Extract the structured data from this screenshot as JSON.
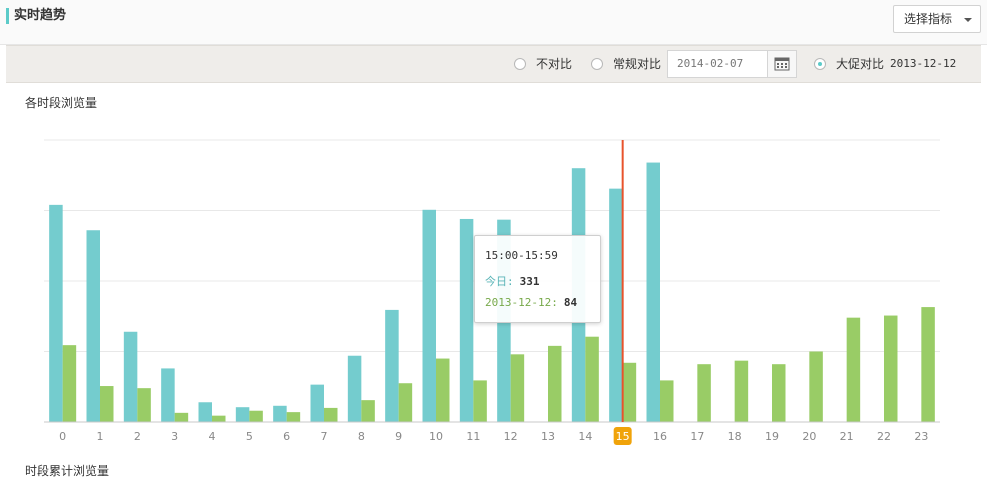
{
  "header": {
    "title": "实时趋势",
    "select_label": "选择指标"
  },
  "compare": {
    "options": [
      {
        "label": "不对比",
        "checked": false
      },
      {
        "label": "常规对比",
        "checked": false
      },
      {
        "label": "大促对比",
        "checked": true
      }
    ],
    "regular_date": "2014-02-07",
    "promo_date": "2013-12-12"
  },
  "sections": {
    "hourly_title": "各时段浏览量",
    "cumulative_title": "时段累计浏览量"
  },
  "colors": {
    "today": "#74ccce",
    "compare": "#99cc66",
    "marker": "#e8532c",
    "highlight": "#f0a30a"
  },
  "chart_data": {
    "type": "bar",
    "categories": [
      "0",
      "1",
      "2",
      "3",
      "4",
      "5",
      "6",
      "7",
      "8",
      "9",
      "10",
      "11",
      "12",
      "13",
      "14",
      "15",
      "16",
      "17",
      "18",
      "19",
      "20",
      "21",
      "22",
      "23"
    ],
    "ylim": [
      0,
      400
    ],
    "grid": true,
    "series": [
      {
        "name": "今日",
        "values": [
          308,
          272,
          128,
          76,
          28,
          21,
          23,
          53,
          94,
          159,
          301,
          288,
          287,
          null,
          360,
          331,
          368,
          null,
          null,
          null,
          null,
          null,
          null,
          null
        ]
      },
      {
        "name": "2013-12-12",
        "values": [
          109,
          51,
          48,
          13,
          9,
          16,
          14,
          20,
          31,
          55,
          90,
          59,
          96,
          108,
          121,
          84,
          59,
          82,
          87,
          82,
          100,
          148,
          151,
          163
        ]
      }
    ],
    "highlight_category": "15"
  },
  "tooltip": {
    "time": "15:00-15:59",
    "today_label": "今日:",
    "today_value": "331",
    "compare_label": "2013-12-12:",
    "compare_value": "84"
  }
}
